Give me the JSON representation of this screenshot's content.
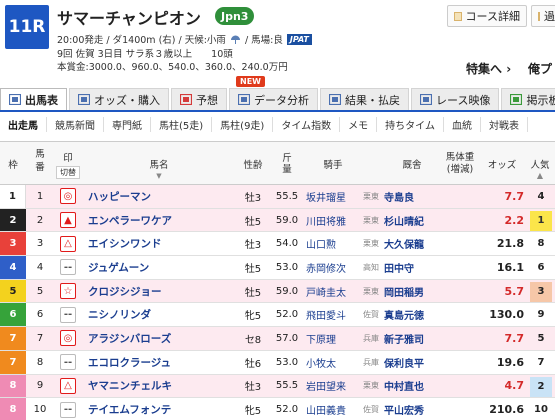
{
  "header": {
    "race_no": "11R",
    "race_name": "サマーチャンピオン",
    "grade": "Jpn3",
    "btn_detail": "コース詳細",
    "btn_other": "過去",
    "info1_a": "20:00発走 / ダ1400m (右) / 天候:小雨",
    "info1_b": "/ 馬場:良",
    "ipat": "JPAT",
    "info2": "9回 佐賀 3日目 サラ系３歳以上　　10頭",
    "info3": "本賞金:3000.0、960.0、540.0、360.0、240.0万円",
    "special": "特集へ",
    "other_link": "俺プ"
  },
  "tabs": [
    {
      "label": "出馬表",
      "icon": "table-icon",
      "active": true
    },
    {
      "label": "オッズ・購入",
      "icon": "ticket-icon",
      "active": false
    },
    {
      "label": "予想",
      "icon": "target-icon",
      "active": false
    },
    {
      "label": "データ分析",
      "icon": "bar-chart-icon",
      "active": false
    },
    {
      "label": "結果・払戻",
      "icon": "grid-icon",
      "active": false
    },
    {
      "label": "レース映像",
      "icon": "video-icon",
      "active": false
    },
    {
      "label": "掲示板",
      "icon": "chat-icon",
      "active": false
    }
  ],
  "new_badge": "NEW",
  "subnav": [
    "出走馬",
    "競馬新聞",
    "専門紙",
    "馬柱(5走)",
    "馬柱(9走)",
    "タイム指数",
    "メモ",
    "持ちタイム",
    "血統",
    "対戦表"
  ],
  "thead": {
    "waku": "枠",
    "umaban1": "馬",
    "umaban2": "番",
    "mark1": "印",
    "mark2": "切替",
    "horse": "馬名",
    "sex": "性齢",
    "weight1": "斤",
    "weight2": "量",
    "jockey": "騎手",
    "trainer": "厩舎",
    "bw1": "馬体重",
    "bw2": "(増減)",
    "odds": "オッズ",
    "pop1": "人気",
    "pop2": "▲"
  },
  "waku_colors": {
    "1": {
      "bg": "#ffffff",
      "fg": "#222222"
    },
    "2": {
      "bg": "#222222",
      "fg": "#ffffff"
    },
    "3": {
      "bg": "#e8413a",
      "fg": "#ffffff"
    },
    "4": {
      "bg": "#2f5fc8",
      "fg": "#ffffff"
    },
    "5": {
      "bg": "#f3d21e",
      "fg": "#222222"
    },
    "6": {
      "bg": "#36a33a",
      "fg": "#ffffff"
    },
    "7": {
      "bg": "#f08a1e",
      "fg": "#ffffff"
    },
    "8": {
      "bg": "#ef8bb4",
      "fg": "#ffffff"
    }
  },
  "horses": [
    {
      "waku": "1",
      "uma": "1",
      "mark": "◎",
      "mark_red": true,
      "name": "ハッピーマン",
      "sex": "牡3",
      "kin": "55.5",
      "jockey": "坂井瑠星",
      "belong": "栗東",
      "trainer": "寺島良",
      "odds": "7.7",
      "odds_red": true,
      "pop": "4",
      "pop_cls": "",
      "pink": true
    },
    {
      "waku": "2",
      "uma": "2",
      "mark": "▲",
      "mark_red": true,
      "name": "エンペラーワケア",
      "sex": "牡5",
      "kin": "59.0",
      "jockey": "川田将雅",
      "belong": "栗東",
      "trainer": "杉山晴紀",
      "odds": "2.2",
      "odds_red": true,
      "pop": "1",
      "pop_cls": "y",
      "pink": true
    },
    {
      "waku": "3",
      "uma": "3",
      "mark": "△",
      "mark_red": true,
      "name": "エイシンワンド",
      "sex": "牡3",
      "kin": "54.0",
      "jockey": "山口勲",
      "belong": "栗東",
      "trainer": "大久保龍",
      "odds": "21.8",
      "odds_red": false,
      "pop": "8",
      "pop_cls": "",
      "pink": false
    },
    {
      "waku": "4",
      "uma": "4",
      "mark": "--",
      "mark_red": false,
      "name": "ジュゲムーン",
      "sex": "牡5",
      "kin": "53.0",
      "jockey": "赤岡修次",
      "belong": "高知",
      "trainer": "田中守",
      "odds": "16.1",
      "odds_red": false,
      "pop": "6",
      "pop_cls": "",
      "pink": false
    },
    {
      "waku": "5",
      "uma": "5",
      "mark": "☆",
      "mark_red": true,
      "name": "クロジシジョー",
      "sex": "牡5",
      "kin": "59.0",
      "jockey": "戸崎圭太",
      "belong": "栗東",
      "trainer": "岡田稲男",
      "odds": "5.7",
      "odds_red": true,
      "pop": "3",
      "pop_cls": "o",
      "pink": true
    },
    {
      "waku": "6",
      "uma": "6",
      "mark": "--",
      "mark_red": false,
      "name": "ニシノリンダ",
      "sex": "牝5",
      "kin": "52.0",
      "jockey": "飛田愛斗",
      "belong": "佐賀",
      "trainer": "真島元徳",
      "odds": "130.0",
      "odds_red": false,
      "pop": "9",
      "pop_cls": "",
      "pink": false
    },
    {
      "waku": "7",
      "uma": "7",
      "mark": "◎",
      "mark_red": true,
      "name": "アラジンバローズ",
      "sex": "セ8",
      "kin": "57.0",
      "jockey": "下原理",
      "belong": "兵庫",
      "trainer": "新子雅司",
      "odds": "7.7",
      "odds_red": true,
      "pop": "5",
      "pop_cls": "",
      "pink": true
    },
    {
      "waku": "7",
      "uma": "8",
      "mark": "--",
      "mark_red": false,
      "name": "エコロクラージュ",
      "sex": "牡6",
      "kin": "53.0",
      "jockey": "小牧太",
      "belong": "兵庫",
      "trainer": "保利良平",
      "odds": "19.6",
      "odds_red": false,
      "pop": "7",
      "pop_cls": "",
      "pink": false
    },
    {
      "waku": "8",
      "uma": "9",
      "mark": "△",
      "mark_red": true,
      "name": "ヤマニンチェルキ",
      "sex": "牡3",
      "kin": "55.5",
      "jockey": "岩田望来",
      "belong": "栗東",
      "trainer": "中村直也",
      "odds": "4.7",
      "odds_red": true,
      "pop": "2",
      "pop_cls": "b",
      "pink": true
    },
    {
      "waku": "8",
      "uma": "10",
      "mark": "--",
      "mark_red": false,
      "name": "テイエムフォンテ",
      "sex": "牝5",
      "kin": "52.0",
      "jockey": "山田義貴",
      "belong": "佐賀",
      "trainer": "平山宏秀",
      "odds": "210.6",
      "odds_red": false,
      "pop": "10",
      "pop_cls": "",
      "pink": false
    }
  ]
}
